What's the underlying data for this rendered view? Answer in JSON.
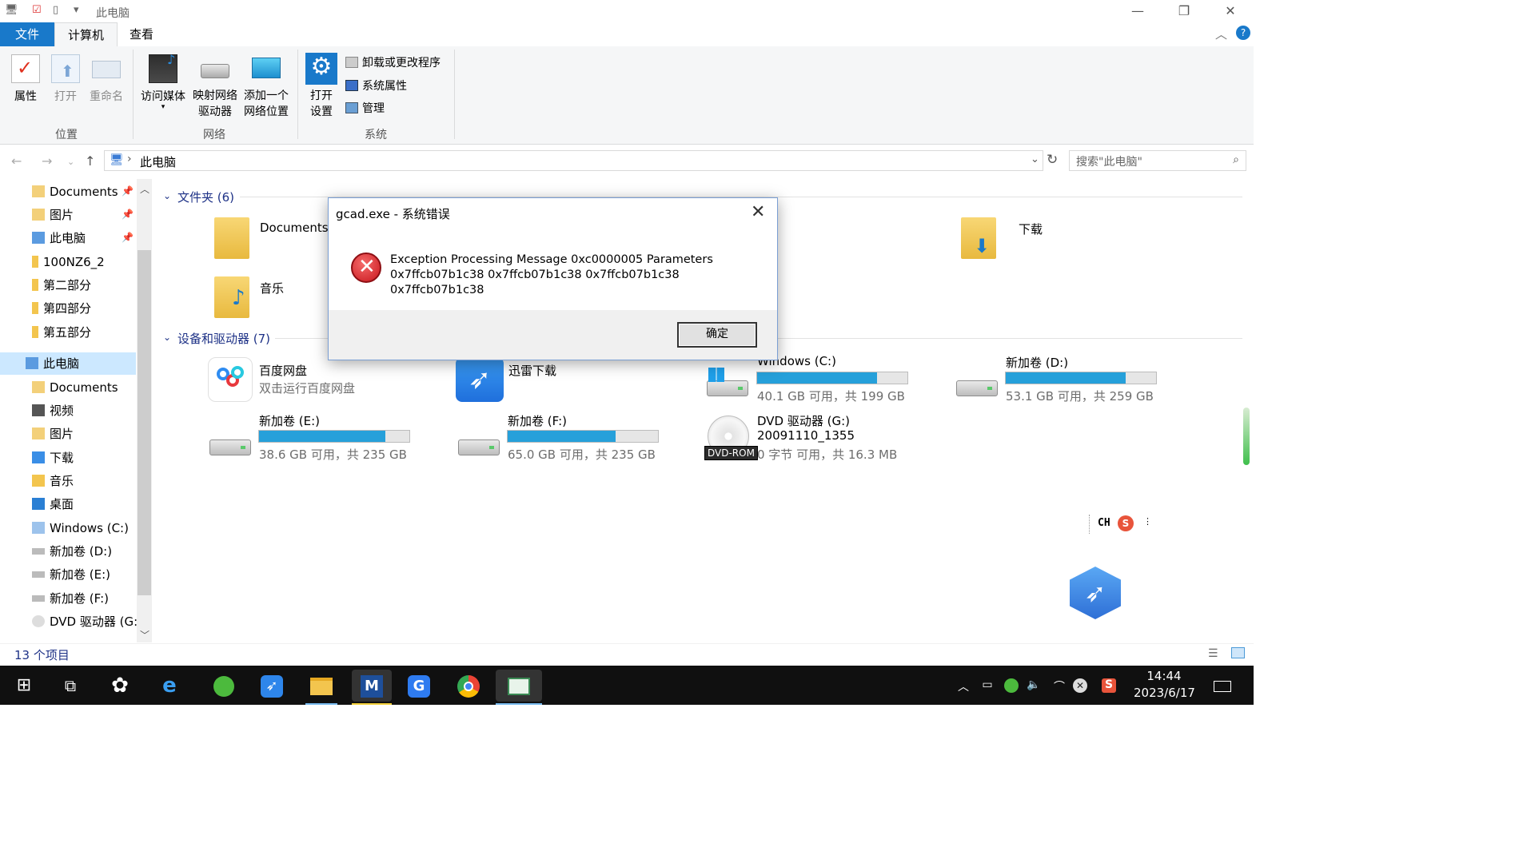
{
  "window": {
    "title": "此电脑",
    "controls": {
      "minimize": "—",
      "restore": "❐",
      "close": "✕"
    }
  },
  "ribbon_tabs": [
    {
      "label": "文件"
    },
    {
      "label": "计算机"
    },
    {
      "label": "查看"
    }
  ],
  "ribbon": {
    "location_group": {
      "label": "位置",
      "buttons": [
        "属性",
        "打开",
        "重命名"
      ]
    },
    "network_group": {
      "label": "网络",
      "access_media": "访问媒体",
      "map_drive_line1": "映射网络",
      "map_drive_line2": "驱动器",
      "add_location_line1": "添加一个",
      "add_location_line2": "网络位置"
    },
    "system_group": {
      "label": "系统",
      "open_settings_line1": "打开",
      "open_settings_line2": "设置",
      "items": [
        "卸载或更改程序",
        "系统属性",
        "管理"
      ]
    }
  },
  "address": {
    "path": "此电脑",
    "search_placeholder": "搜索\"此电脑\""
  },
  "nav_pane": {
    "quick": [
      {
        "label": "Documents",
        "pinned": true
      },
      {
        "label": "图片",
        "pinned": true
      },
      {
        "label": "此电脑",
        "pinned": true
      },
      {
        "label": "100NZ6_2",
        "pinned": false
      },
      {
        "label": "第二部分",
        "pinned": false
      },
      {
        "label": "第四部分",
        "pinned": false
      },
      {
        "label": "第五部分",
        "pinned": false
      }
    ],
    "this_pc": "此电脑",
    "children": [
      "Documents",
      "视频",
      "图片",
      "下载",
      "音乐",
      "桌面",
      "Windows (C:)",
      "新加卷 (D:)",
      "新加卷 (E:)",
      "新加卷 (F:)",
      "DVD 驱动器 (G:)"
    ]
  },
  "folders_section": {
    "header": "文件夹 (6)",
    "items": [
      {
        "name": "Documents"
      },
      {
        "name": "下载"
      },
      {
        "name": "音乐"
      }
    ]
  },
  "devices_section": {
    "header": "设备和驱动器 (7)",
    "apps": [
      {
        "name": "百度网盘",
        "sub": "双击运行百度网盘"
      },
      {
        "name": "迅雷下载",
        "sub": ""
      }
    ],
    "drives": [
      {
        "name": "Windows (C:)",
        "info": "40.1 GB 可用，共 199 GB",
        "used_fraction": 0.8
      },
      {
        "name": "新加卷 (D:)",
        "info": "53.1 GB 可用，共 259 GB",
        "used_fraction": 0.8
      },
      {
        "name": "新加卷 (E:)",
        "info": "38.6 GB 可用，共 235 GB",
        "used_fraction": 0.84
      },
      {
        "name": "新加卷 (F:)",
        "info": "65.0 GB 可用，共 235 GB",
        "used_fraction": 0.72
      }
    ],
    "dvd": {
      "name": "DVD 驱动器 (G:)",
      "label": "20091110_1355",
      "info": "0 字节 可用，共 16.3 MB",
      "badge": "DVD-ROM"
    }
  },
  "status_bar": {
    "count": "13 个项目"
  },
  "dialog": {
    "title": "gcad.exe - 系统错误",
    "message_line1": "Exception Processing Message 0xc0000005 Parameters",
    "message_line2": "0x7ffcb07b1c38 0x7ffcb07b1c38 0x7ffcb07b1c38 0x7ffcb07b1c38",
    "ok_label": "确定"
  },
  "ime": {
    "label": "CH"
  },
  "taskbar": {
    "clock_time": "14:44",
    "clock_date": "2023/6/17"
  },
  "colors": {
    "accent": "#1979ca",
    "bar_fill": "#26a0da",
    "section_header": "#1e3287",
    "taskbar": "#101010"
  }
}
